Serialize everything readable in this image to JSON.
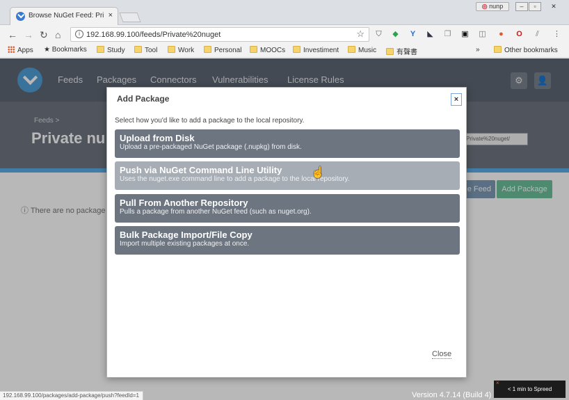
{
  "browser": {
    "tab_title": "Browse NuGet Feed: Priv",
    "tab_close": "×",
    "url": "192.168.99.100/feeds/Private%20nuget",
    "user_badge": "nunp",
    "bookmarks": [
      {
        "label": "Apps",
        "icon": "apps-grid-icon"
      },
      {
        "label": "Bookmarks",
        "icon": "star-icon"
      },
      {
        "label": "Study",
        "icon": "folder-icon"
      },
      {
        "label": "Tool",
        "icon": "folder-icon"
      },
      {
        "label": "Work",
        "icon": "folder-icon"
      },
      {
        "label": "Personal",
        "icon": "folder-icon"
      },
      {
        "label": "MOOCs",
        "icon": "folder-icon"
      },
      {
        "label": "Investiment",
        "icon": "folder-icon"
      },
      {
        "label": "Music",
        "icon": "folder-icon"
      },
      {
        "label": "有聲書",
        "icon": "folder-icon"
      }
    ],
    "bookmarks_overflow": "»",
    "other_bookmarks": "Other bookmarks"
  },
  "nav": {
    "items": [
      "Feeds",
      "Packages",
      "Connectors",
      "Vulnerabilities",
      "License Rules"
    ]
  },
  "hero": {
    "breadcrumb": "Feeds >",
    "feed_name": "Private nu",
    "feed_url": "Private%20nuget/"
  },
  "page": {
    "btn_feed_partial": "ge Feed",
    "btn_add_package": "Add Package",
    "no_packages": "ⓘ There are no package"
  },
  "modal": {
    "title": "Add Package",
    "close_x": "×",
    "intro": "Select how you'd like to add a package to the local repository.",
    "options": [
      {
        "title": "Upload from Disk",
        "desc": "Upload a pre-packaged NuGet package (.nupkg) from disk."
      },
      {
        "title": "Push via NuGet Command Line Utility",
        "desc": "Uses the nuget.exe command line to add a package to the local repository."
      },
      {
        "title": "Pull From Another Repository",
        "desc": "Pulls a package from another NuGet feed (such as nuget.org)."
      },
      {
        "title": "Bulk Package Import/File Copy",
        "desc": "Import multiple existing packages at once."
      }
    ],
    "close_link": "Close"
  },
  "status": {
    "hover_url": "192.168.99.100/packages/add-package/push?feedId=1",
    "version": "Version 4.7.14 (Build 4)",
    "spreed": "< 1 min to Spreed",
    "spreed_close": "×"
  },
  "colors": {
    "nav_bg": "#5f6773",
    "hero_bg": "#6f7782",
    "accent_blue": "#5aaee6",
    "option_bg": "#6d7580",
    "option_hover_bg": "#a7adb4",
    "add_button": "#6bbf9a"
  }
}
